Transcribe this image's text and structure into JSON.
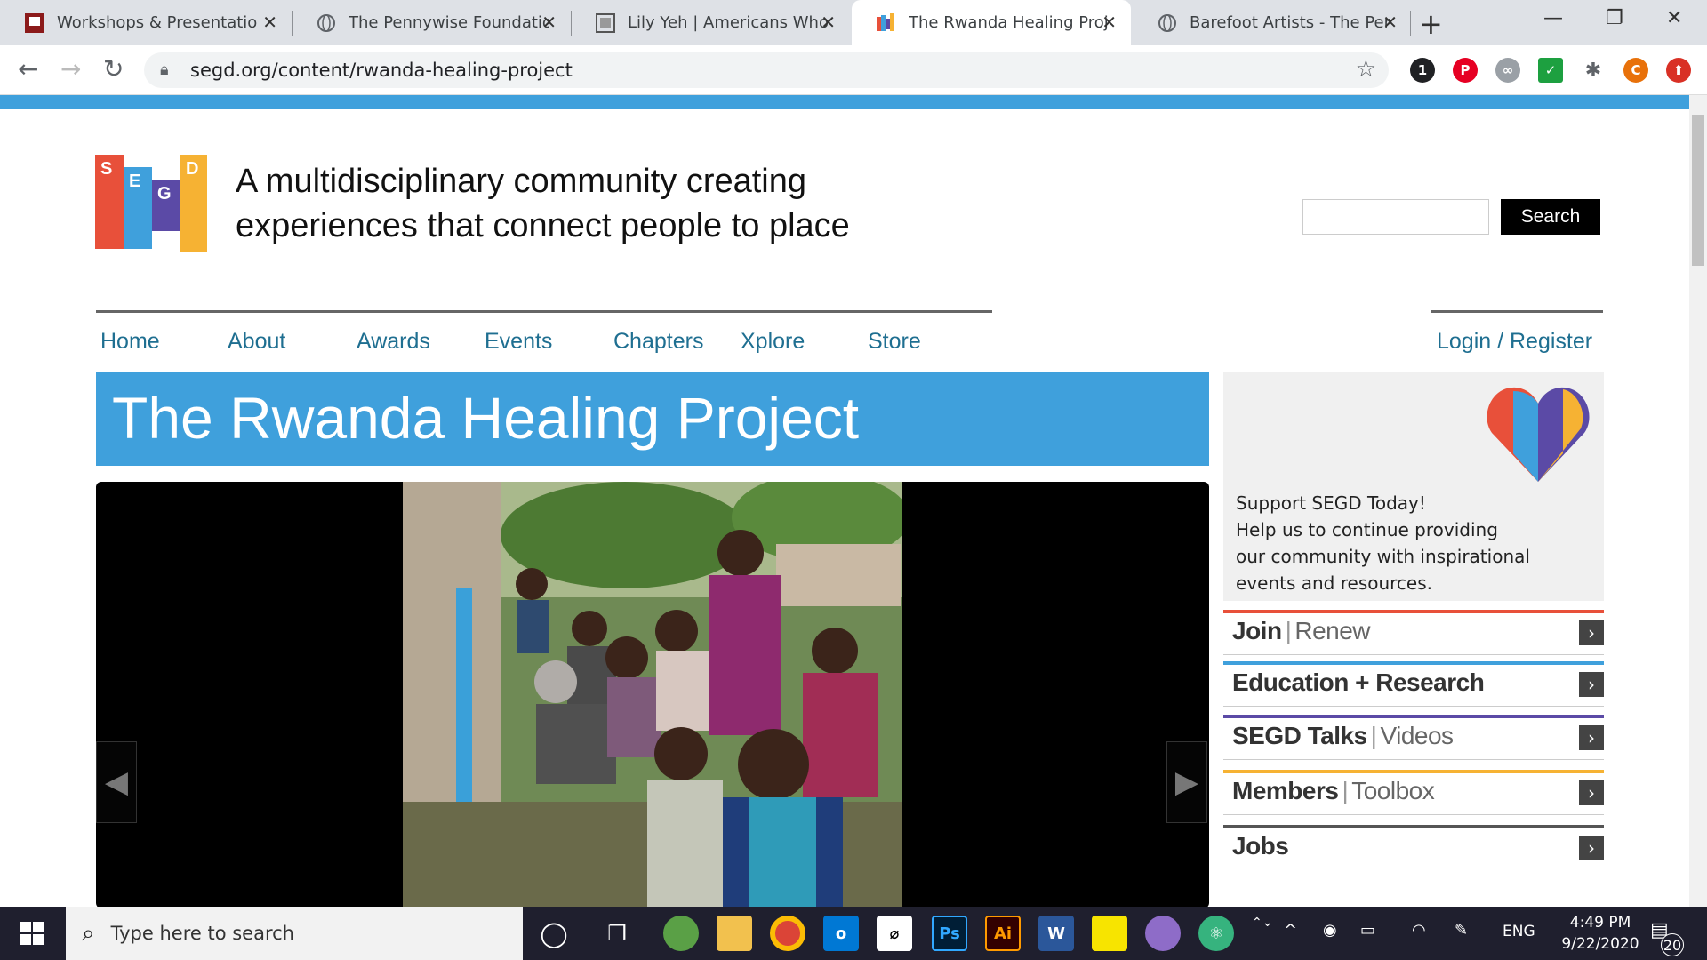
{
  "browser": {
    "tabs": [
      {
        "title": "Workshops & Presentations",
        "active": false
      },
      {
        "title": "The Pennywise Foundation",
        "active": false
      },
      {
        "title": "Lily Yeh | Americans Who Te",
        "active": false
      },
      {
        "title": "The Rwanda Healing Projec",
        "active": true
      },
      {
        "title": "Barefoot Artists - The Penny",
        "active": false
      }
    ],
    "url": "segd.org/content/rwanda-healing-project",
    "extensions": [
      {
        "label": "1",
        "color": "#202124"
      },
      {
        "label": "P",
        "color": "#e60023"
      },
      {
        "label": "∞",
        "color": "#9aa0a6"
      },
      {
        "label": "✓",
        "color": "#1da040"
      },
      {
        "label": "✱",
        "color": "#5f6368"
      },
      {
        "label": "C",
        "color": "#e8710a"
      },
      {
        "label": "⬆",
        "color": "#d93025"
      }
    ]
  },
  "site": {
    "tagline_line1": "A multidisciplinary community creating",
    "tagline_line2": "experiences that connect people to place",
    "search_label": "Search",
    "nav": [
      "Home",
      "About",
      "Awards",
      "Events",
      "Chapters",
      "Xplore",
      "Store"
    ],
    "login": "Login / Register",
    "page_title": "The Rwanda Healing Project",
    "donate": {
      "line1": "Support SEGD Today!",
      "line2": "Help us to continue providing",
      "line3": "our community with inspirational",
      "line4": "events and resources."
    },
    "sidebar_links": [
      {
        "bold": "Join",
        "light": "Renew",
        "color": "#e8503a"
      },
      {
        "bold": "Education + Research",
        "light": "",
        "color": "#3fa0dc"
      },
      {
        "bold": "SEGD Talks",
        "light": "Videos",
        "color": "#5b4aa6"
      },
      {
        "bold": "Members",
        "light": "Toolbox",
        "color": "#f6b233"
      },
      {
        "bold": "Jobs",
        "light": "",
        "color": "#555555"
      }
    ]
  },
  "taskbar": {
    "search_placeholder": "Type here to search",
    "language": "ENG",
    "time": "4:49 PM",
    "date": "9/22/2020",
    "notifications": "20"
  }
}
